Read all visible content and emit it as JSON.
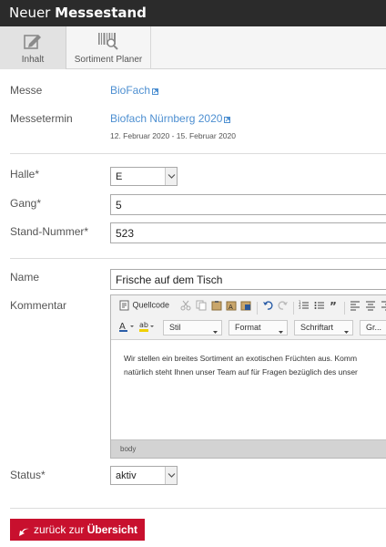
{
  "window": {
    "title_prefix": "Neuer",
    "title_bold": "Messestand"
  },
  "tabs": [
    {
      "label": "Inhalt",
      "icon": "edit-icon",
      "active": true
    },
    {
      "label": "Sortiment Planer",
      "icon": "barcode-scan-icon",
      "active": false
    }
  ],
  "fields": {
    "messe": {
      "label": "Messe",
      "value": "BioFach"
    },
    "messetermin": {
      "label": "Messetermin",
      "value": "Biofach Nürnberg 2020",
      "dates": "12. Februar 2020 - 15. Februar 2020"
    },
    "halle": {
      "label": "Halle*",
      "value": "E"
    },
    "gang": {
      "label": "Gang*",
      "value": "5"
    },
    "stand": {
      "label": "Stand-Nummer*",
      "value": "523"
    },
    "name": {
      "label": "Name",
      "value": "Frische auf dem Tisch"
    },
    "kommentar": {
      "label": "Kommentar"
    },
    "status": {
      "label": "Status*",
      "value": "aktiv"
    }
  },
  "editor": {
    "source_label": "Quellcode",
    "combos": {
      "stil": "Stil",
      "format": "Format",
      "font": "Schriftart",
      "size": "Gr..."
    },
    "content_line1": "Wir stellen ein breites Sortiment an exotischen Früchten aus. Komm",
    "content_line2": "natürlich steht Ihnen unser Team auf für Fragen bezüglich des unser",
    "path": "body"
  },
  "back_button": {
    "prefix": "zurück zur",
    "bold": "Übersicht"
  },
  "colors": {
    "header_bg": "#2b2b2b",
    "link": "#4d8fd1",
    "button_bg": "#c8102e"
  }
}
